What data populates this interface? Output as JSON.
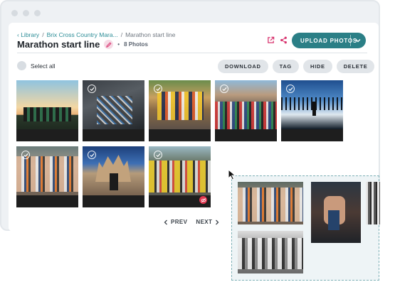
{
  "breadcrumb": {
    "library": "Library",
    "parent": "Brix Cross Country Mara...",
    "separator": "/",
    "current": "Marathon start line"
  },
  "album": {
    "title": "Marathon start line",
    "photo_count": "8 Photos",
    "bullet": "•"
  },
  "header": {
    "upload_label": "UPLOAD PHOTOS"
  },
  "toolbar": {
    "select_all_label": "Select all",
    "download_label": "DOWNLOAD",
    "tag_label": "TAG",
    "hide_label": "HIDE",
    "delete_label": "DELETE"
  },
  "photos": [
    {
      "subject": "graduates throwing caps at sunset",
      "check": true
    },
    {
      "subject": "aerial runners on road",
      "check": true
    },
    {
      "subject": "runners in sunlight",
      "check": true
    },
    {
      "subject": "crowd at city start line",
      "check": true
    },
    {
      "subject": "runner silhouette at harbour",
      "check": true
    },
    {
      "subject": "runners close-up",
      "check": true
    },
    {
      "subject": "runner at cathedral",
      "check": true
    },
    {
      "subject": "runners in yellow shirts",
      "check": true,
      "badge": "hidden-icon"
    }
  ],
  "pagination": {
    "prev_label": "PREV",
    "next_label": "NEXT"
  },
  "colors": {
    "accent": "#2b7f86",
    "link": "#2a8c96",
    "badge": "#e0364f",
    "icon_pink": "#d8336e"
  },
  "dropzone": {
    "images": [
      "runners crowd close-up",
      "medal held in hand",
      "black and white runners on street",
      "black and white runners partial"
    ]
  }
}
